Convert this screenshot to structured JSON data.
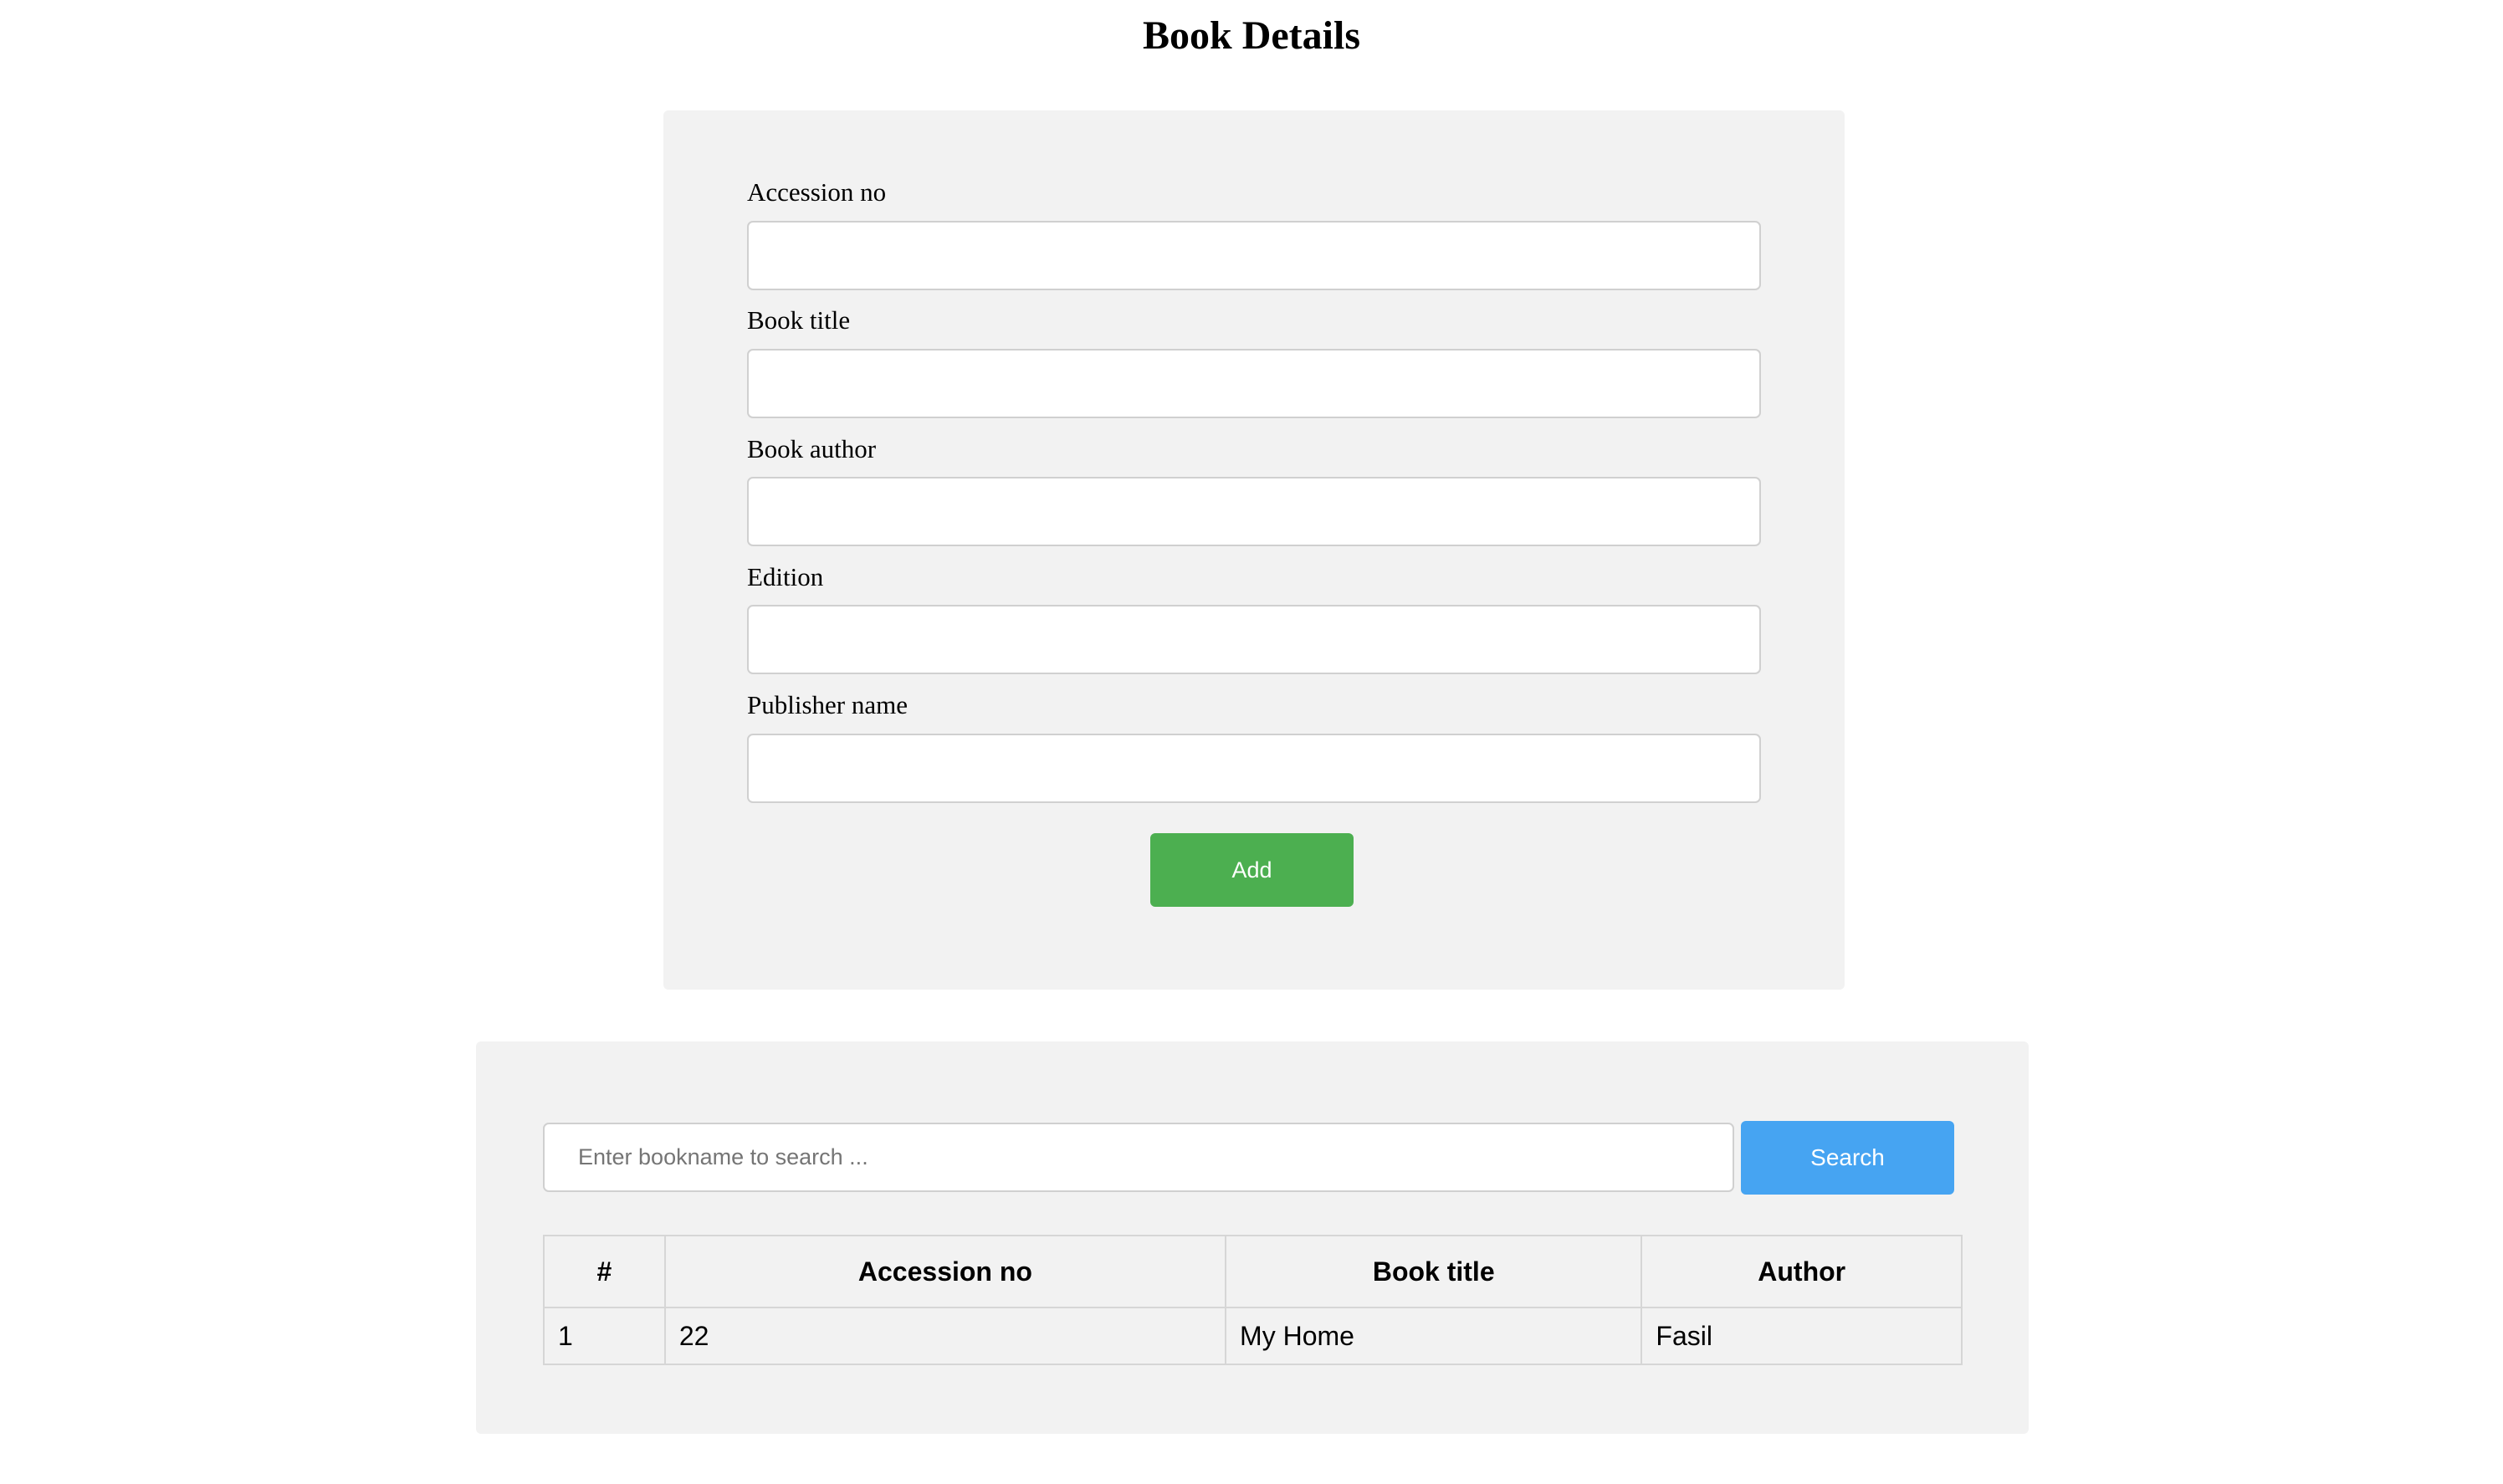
{
  "page": {
    "title": "Book Details"
  },
  "form": {
    "fields": [
      {
        "label": "Accession no",
        "value": ""
      },
      {
        "label": "Book title",
        "value": ""
      },
      {
        "label": "Book author",
        "value": ""
      },
      {
        "label": "Edition",
        "value": ""
      },
      {
        "label": "Publisher name",
        "value": ""
      }
    ],
    "add_label": "Add"
  },
  "search": {
    "placeholder": "Enter bookname to search ...",
    "value": "",
    "button_label": "Search"
  },
  "table": {
    "headers": [
      "#",
      "Accession no",
      "Book title",
      "Author"
    ],
    "rows": [
      [
        "1",
        "22",
        "My Home",
        "Fasil"
      ]
    ]
  },
  "colors": {
    "add_button": "#4caf50",
    "search_button": "#46a4f2",
    "card_background": "#f2f2f2"
  }
}
